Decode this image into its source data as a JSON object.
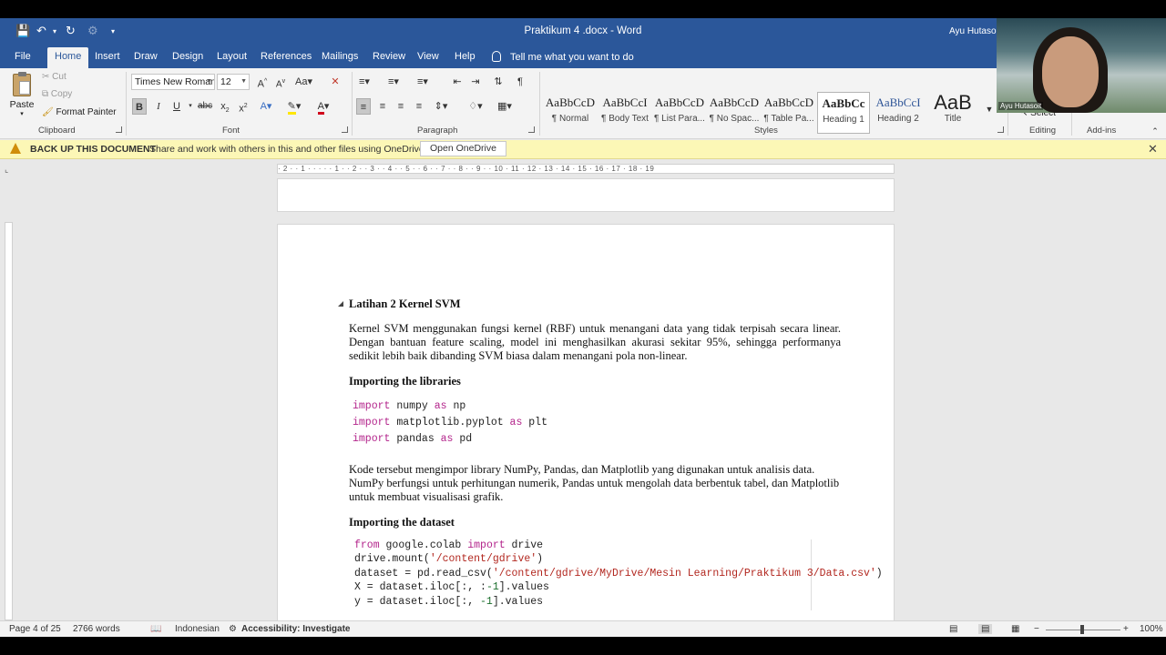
{
  "window": {
    "title": "Praktikum 4 .docx  -  Word",
    "user": "Ayu Hutasoit"
  },
  "tabs": [
    {
      "label": "File"
    },
    {
      "label": "Home"
    },
    {
      "label": "Insert"
    },
    {
      "label": "Draw"
    },
    {
      "label": "Design"
    },
    {
      "label": "Layout"
    },
    {
      "label": "References"
    },
    {
      "label": "Mailings"
    },
    {
      "label": "Review"
    },
    {
      "label": "View"
    },
    {
      "label": "Help"
    }
  ],
  "tell_me": "Tell me what you want to do",
  "ribbon": {
    "clipboard": {
      "paste": "Paste",
      "cut": "Cut",
      "copy": "Copy",
      "format_painter": "Format Painter",
      "label": "Clipboard"
    },
    "font": {
      "family": "Times New Roman",
      "size": "12",
      "label": "Font"
    },
    "paragraph": {
      "label": "Paragraph"
    },
    "styles": {
      "label": "Styles",
      "items": [
        {
          "sample": "AaBbCcD",
          "name": "¶ Normal"
        },
        {
          "sample": "AaBbCcI",
          "name": "¶ Body Text"
        },
        {
          "sample": "AaBbCcD",
          "name": "¶ List Para..."
        },
        {
          "sample": "AaBbCcD",
          "name": "¶ No Spac..."
        },
        {
          "sample": "AaBbCcD",
          "name": "¶ Table Pa..."
        },
        {
          "sample": "AaBbCc",
          "name": "Heading 1"
        },
        {
          "sample": "AaBbCcI",
          "name": "Heading 2"
        },
        {
          "sample": "AaB",
          "name": "Title"
        }
      ]
    },
    "editing": {
      "select": "Select",
      "label": "Editing"
    },
    "addins": {
      "label": "Add-ins"
    }
  },
  "notification": {
    "title": "BACK UP THIS DOCUMENT",
    "text": "Share and work with others in this and other files using OneDrive.",
    "button": "Open OneDrive"
  },
  "ruler": {
    "text": "· 2 · · 1 · · · · · 1 · · 2 · · 3 · · 4 · · 5 · · 6 · · 7 · · 8 · · 9 · · 10 · 11 · 12 · 13 · 14 · 15 · 16 · 17 · 18 · 19"
  },
  "document": {
    "heading": "Latihan 2 Kernel SVM",
    "intro": "Kernel SVM menggunakan fungsi kernel (RBF) untuk menangani data yang tidak terpisah secara linear. Dengan bantuan feature scaling, model ini menghasilkan akurasi sekitar 95%, sehingga performanya sedikit lebih baik dibanding SVM biasa dalam menangani pola non-linear.",
    "section1": "Importing the libraries",
    "code1": [
      {
        "kw": "import",
        "rest": " numpy ",
        "kw2": "as",
        "tail": " np"
      },
      {
        "kw": "import",
        "rest": " matplotlib.pyplot ",
        "kw2": "as",
        "tail": " plt"
      },
      {
        "kw": "import",
        "rest": " pandas ",
        "kw2": "as",
        "tail": " pd"
      }
    ],
    "para2": "Kode tersebut mengimpor library NumPy, Pandas, dan Matplotlib yang digunakan untuk analisis data. NumPy berfungsi untuk perhitungan numerik, Pandas untuk mengolah data berbentuk tabel, dan Matplotlib untuk membuat visualisasi grafik.",
    "section2": "Importing the dataset",
    "code2": {
      "l1_kw1": "from",
      "l1_mid": " google.colab ",
      "l1_kw2": "import",
      "l1_tail": " drive",
      "l2_pre": "drive.mount(",
      "l2_str": "'/content/gdrive'",
      "l2_post": ")",
      "l3_pre": "dataset = pd.read_csv(",
      "l3_str": "'/content/gdrive/MyDrive/Mesin Learning/Praktikum 3/Data.csv'",
      "l3_post": ")",
      "l4_pre": "X = dataset.iloc[:, :",
      "l4_num": "-1",
      "l4_post": "].values",
      "l5_pre": "y = dataset.iloc[:, ",
      "l5_num": "-1",
      "l5_post": "].values"
    }
  },
  "status": {
    "page": "Page 4 of 25",
    "words": "2766 words",
    "language": "Indonesian",
    "accessibility": "Accessibility: Investigate",
    "zoom": "100%"
  },
  "webcam": {
    "label": "Ayu Hutasoit"
  }
}
